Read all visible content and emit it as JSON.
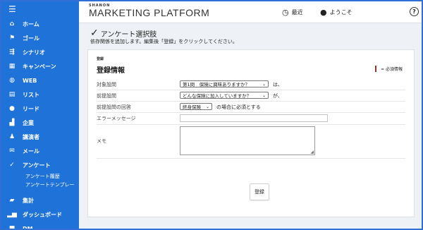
{
  "sidebar": {
    "items": [
      {
        "label": "ホーム",
        "icon": "home-icon"
      },
      {
        "label": "ゴール",
        "icon": "flag-icon"
      },
      {
        "label": "シナリオ",
        "icon": "scenario-icon"
      },
      {
        "label": "キャンペーン",
        "icon": "calendar-icon"
      },
      {
        "label": "WEB",
        "icon": "globe-icon"
      },
      {
        "label": "リスト",
        "icon": "list-icon"
      },
      {
        "label": "リード",
        "icon": "person-icon"
      },
      {
        "label": "企業",
        "icon": "building-icon"
      },
      {
        "label": "講演者",
        "icon": "speaker-icon"
      },
      {
        "label": "メール",
        "icon": "mail-icon"
      },
      {
        "label": "アンケート",
        "icon": "check-icon"
      }
    ],
    "subitems": [
      "アンケート履歴",
      "アンケートテンプレー"
    ],
    "bottom_items": [
      {
        "label": "集計",
        "icon": "stats-icon"
      },
      {
        "label": "ダッシュボード",
        "icon": "chart-icon"
      },
      {
        "label": "DM",
        "icon": "dm-icon"
      }
    ],
    "bg_color": "#1f73d8"
  },
  "header": {
    "logo_small": "SHANON",
    "logo_main": "MARKETING PLATFORM",
    "recent": "最近",
    "welcome": "ようこそ",
    "help": "?"
  },
  "page": {
    "title": "アンケート選択肢",
    "description": "依存関係を追加します。編集後「登録」をクリックしてください。"
  },
  "form": {
    "section_label": "登録",
    "heading": "登録情報",
    "required_note": "= 必須情報",
    "rows": {
      "target_question": {
        "label": "対象設問",
        "value": "第1問　保険に興味ありますか？",
        "suffix": "は、"
      },
      "prerequisite_question": {
        "label": "前提設問",
        "value": "どんな保険に加入していますか？",
        "suffix": "が、"
      },
      "prerequisite_answer": {
        "label": "前提設問の回答",
        "value": "終身保険",
        "suffix": "の場合に必須とする"
      },
      "error_message": {
        "label": "エラーメッセージ",
        "value": ""
      },
      "memo": {
        "label": "メモ",
        "value": ""
      }
    },
    "submit_label": "登録"
  }
}
